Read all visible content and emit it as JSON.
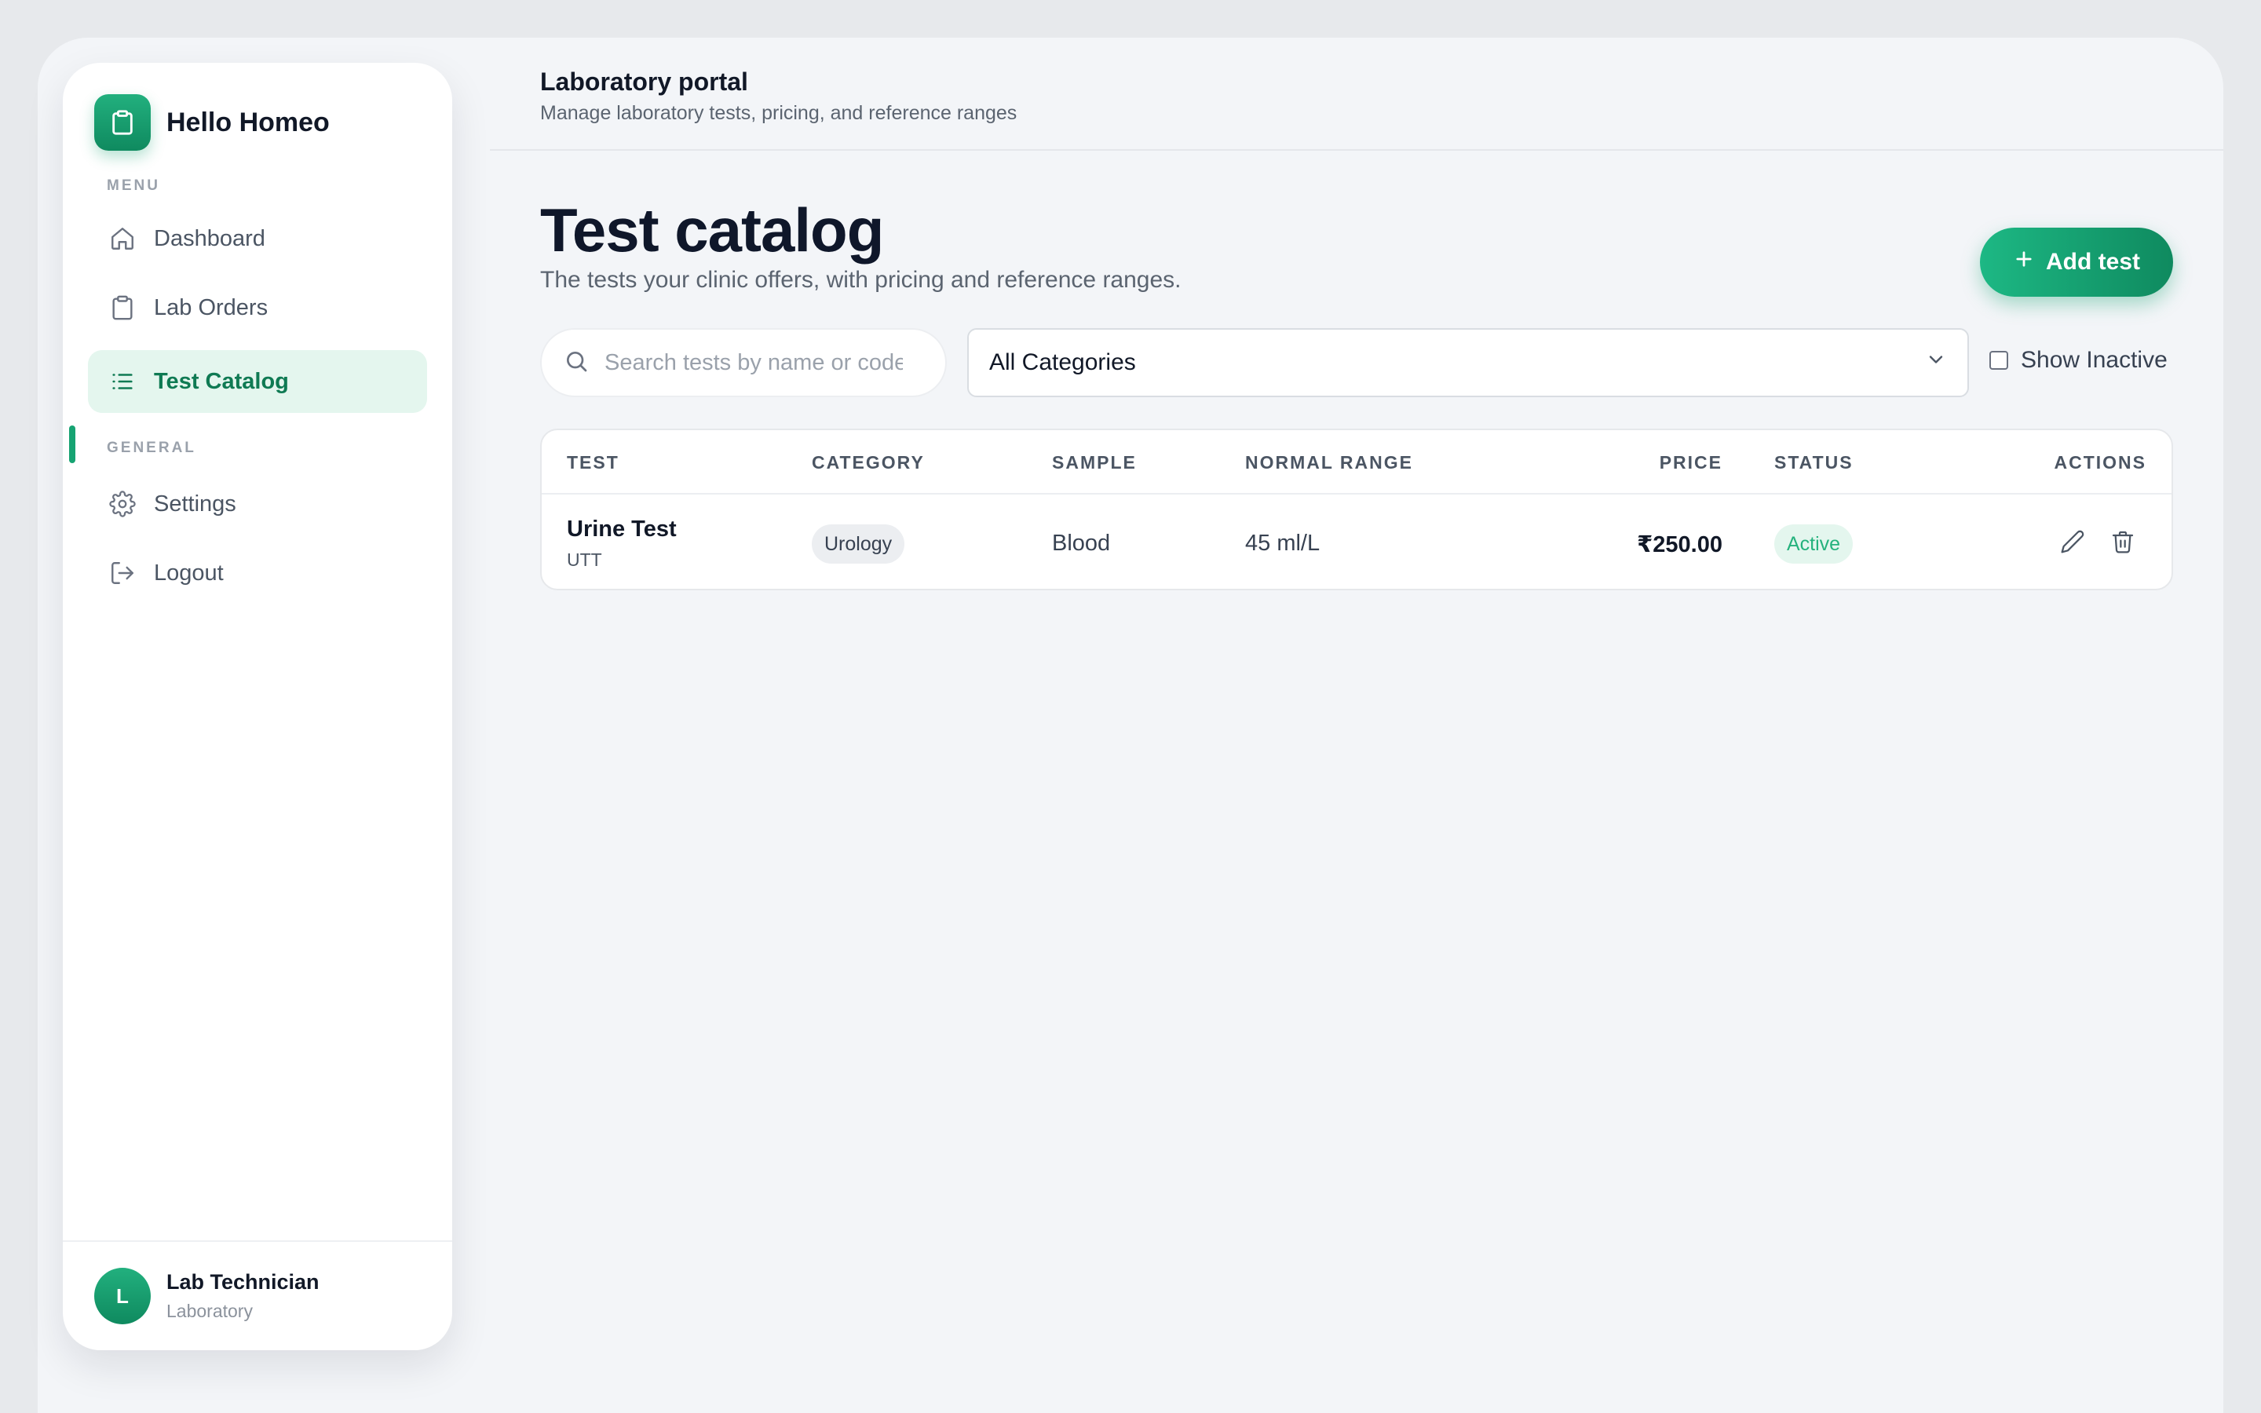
{
  "brand": {
    "name": "Hello Homeo",
    "logo_icon": "clipboard-icon"
  },
  "sidebar": {
    "menu_label": "MENU",
    "general_label": "GENERAL",
    "menu_items": [
      {
        "label": "Dashboard",
        "icon": "home-icon",
        "active": false
      },
      {
        "label": "Lab Orders",
        "icon": "clipboard-icon",
        "active": false
      },
      {
        "label": "Test Catalog",
        "icon": "list-icon",
        "active": true
      }
    ],
    "general_items": [
      {
        "label": "Settings",
        "icon": "gear-icon"
      },
      {
        "label": "Logout",
        "icon": "logout-icon"
      }
    ],
    "user": {
      "initial": "L",
      "name": "Lab Technician",
      "role": "Laboratory"
    }
  },
  "header": {
    "title": "Laboratory portal",
    "subtitle": "Manage laboratory tests, pricing, and reference ranges"
  },
  "main": {
    "title": "Test catalog",
    "subtitle": "The tests your clinic offers, with pricing and reference ranges.",
    "add_button": "Add test",
    "search": {
      "placeholder": "Search tests by name or code",
      "value": ""
    },
    "category_select": {
      "selected": "All Categories"
    },
    "show_inactive": {
      "label": "Show Inactive",
      "checked": false
    }
  },
  "table": {
    "columns": [
      "TEST",
      "CATEGORY",
      "SAMPLE",
      "NORMAL RANGE",
      "PRICE",
      "STATUS",
      "ACTIONS"
    ],
    "rows": [
      {
        "name": "Urine Test",
        "code": "UTT",
        "category": "Urology",
        "sample": "Blood",
        "normal_range": "45 ml/L",
        "price": "₹250.00",
        "status": "Active"
      }
    ]
  },
  "colors": {
    "accent": "#16a372",
    "accent_light": "#e4f6ee",
    "background": "#f3f5f8"
  }
}
